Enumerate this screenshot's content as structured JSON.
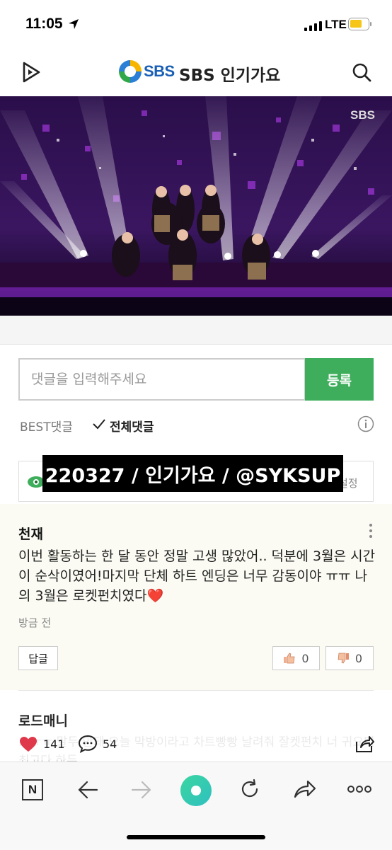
{
  "status_bar": {
    "time": "11:05",
    "network": "LTE"
  },
  "header": {
    "logo_text": "SBS",
    "title": "SBS 인기가요",
    "icons": [
      "play-icon",
      "search-icon"
    ]
  },
  "video": {
    "watermark": "SBS"
  },
  "comment_input": {
    "placeholder": "댓글을 입력해주세요",
    "submit_label": "등록"
  },
  "tabs": {
    "best": "BEST댓글",
    "all": "전체댓글"
  },
  "notice": {
    "setting_label": "설정"
  },
  "overlay": {
    "caption": "220327 / 인기가요 / @SYKSUP"
  },
  "comments": [
    {
      "author": "천재",
      "text": "이번 활동하는 한 달 동안 정말 고생 많았어.. 덕분에 3월은 시간이 순삭이였어!마지막 단체 하트 엔딩은 너무 감동이야 ㅠㅠ 나의 3월은 로켓펀치였다❤️",
      "time": "방금 전",
      "reply_label": "답글",
      "likes": "0",
      "dislikes": "0"
    },
    {
      "author": "로드매니",
      "text": "…ㅠㅠ 말두 안돼 오늘 막방이라고 차트빵빵 날려줘 잘켓펀치 너 귀요미 최고다 하두"
    }
  ],
  "reactions": {
    "likes": "141",
    "comments": "54"
  },
  "bottom_nav": {
    "n_label": "N"
  },
  "colors": {
    "accent_green": "#3fae5c",
    "sbs_blue": "#1a5fb4",
    "heart_red": "#e0384b"
  }
}
